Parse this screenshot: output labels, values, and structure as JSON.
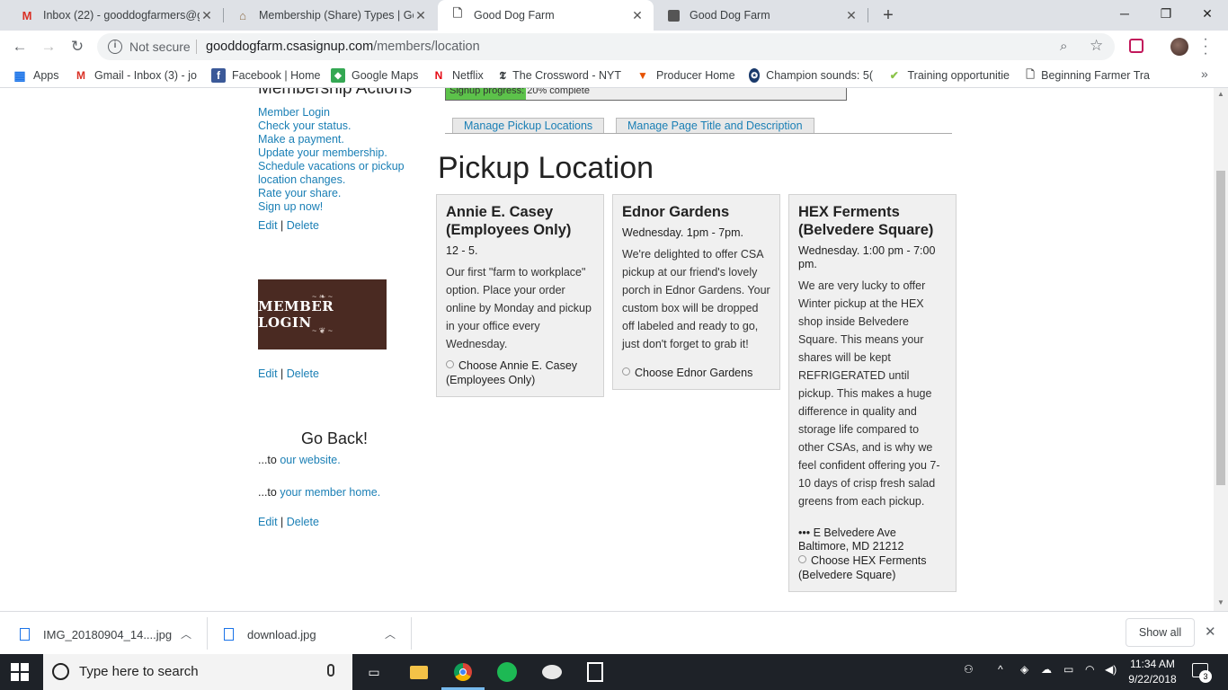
{
  "browser": {
    "tabs": [
      {
        "title": "Inbox (22) - gooddogfarmers@gm",
        "icon": "gmail-icon"
      },
      {
        "title": "Membership (Share) Types | Good",
        "icon": "house-icon"
      },
      {
        "title": "Good Dog Farm",
        "icon": "page-icon"
      },
      {
        "title": "Good Dog Farm",
        "icon": "cube-icon"
      }
    ],
    "security_label": "Not secure",
    "url_host": "gooddogfarm.csasignup.com",
    "url_path": "/members/location",
    "bookmarks": [
      {
        "label": "Apps",
        "icon": "apps-grid-icon"
      },
      {
        "label": "Gmail - Inbox (3) - jo",
        "icon": "gmail-icon"
      },
      {
        "label": "Facebook | Home",
        "icon": "facebook-icon"
      },
      {
        "label": "Google Maps",
        "icon": "maps-icon"
      },
      {
        "label": "Netflix",
        "icon": "netflix-icon"
      },
      {
        "label": "The Crossword - NYT",
        "icon": "nyt-icon"
      },
      {
        "label": "Producer Home",
        "icon": "carrot-icon"
      },
      {
        "label": "Champion sounds: 5(",
        "icon": "champion-icon"
      },
      {
        "label": "Training opportunitie",
        "icon": "leaf-icon"
      },
      {
        "label": "Beginning Farmer Tra",
        "icon": "page-icon"
      }
    ]
  },
  "sidebar": {
    "heading": "Membership Actions",
    "links": [
      "Member Login",
      "Check your status.",
      "Make a payment.",
      "Update your membership.",
      "Schedule vacations or pickup location changes.",
      "Rate your share.",
      "Sign up now!"
    ],
    "edit_label": "Edit",
    "delete_label": "Delete",
    "separator": "|",
    "member_login_image_text": "MEMBER LOGIN",
    "go_back_heading": "Go Back!",
    "go_back_prefix": "...to",
    "website_link": "our website.",
    "member_home_link": "your member home."
  },
  "progress": {
    "label": "Signup progress:",
    "percent_text": "20% complete",
    "fraction": 0.2
  },
  "admin_tabs": [
    "Manage Pickup Locations",
    "Manage Page Title and Description"
  ],
  "page_title": "Pickup Location",
  "locations": [
    {
      "name": "Annie E. Casey (Employees Only)",
      "time": "12 - 5.",
      "description": "Our first \"farm to workplace\" option. Place your order online by Monday and pickup in your office every Wednesday.",
      "address": "",
      "choose_label": "Choose Annie E. Casey (Employees Only)"
    },
    {
      "name": "Ednor Gardens",
      "time": "Wednesday. 1pm - 7pm.",
      "description": "We're delighted to offer CSA pickup at our friend's lovely porch in Ednor Gardens. Your custom box will be dropped off labeled and ready to go, just don't forget to grab it!",
      "address": "",
      "choose_label": "Choose Ednor Gardens"
    },
    {
      "name": "HEX Ferments (Belvedere Square)",
      "time": "Wednesday. 1:00 pm - 7:00 pm.",
      "description": "We are very lucky to offer Winter pickup at the HEX shop inside Belvedere Square. This means your shares will be kept REFRIGERATED until pickup. This makes a huge difference in quality and storage life compared to other CSAs, and is why we feel confident offering you 7-10 days of crisp fresh salad greens from each pickup.",
      "address_line1": "••• E Belvedere Ave",
      "address_line2": "Baltimore, MD 21212",
      "choose_label": "Choose HEX Ferments (Belvedere Square)"
    }
  ],
  "downloads": {
    "items": [
      "IMG_20180904_14....jpg",
      "download.jpg"
    ],
    "show_all": "Show all"
  },
  "taskbar": {
    "search_placeholder": "Type here to search",
    "time": "11:34 AM",
    "date": "9/22/2018",
    "notification_count": "3"
  }
}
